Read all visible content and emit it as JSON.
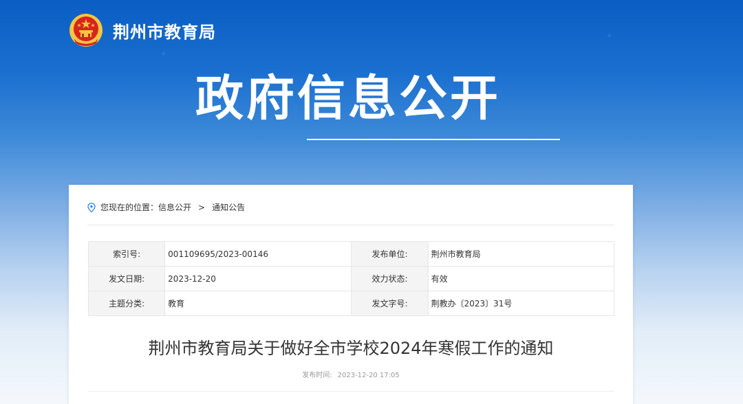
{
  "site": {
    "name": "荆州市教育局",
    "emblem_icon": "national-emblem-icon"
  },
  "hero": {
    "title": "政府信息公开"
  },
  "breadcrumb": {
    "icon": "location-pin-icon",
    "prefix": "您现在的位置：",
    "items": [
      "信息公开",
      "通知公告"
    ],
    "separator": ">"
  },
  "meta": {
    "index_no_label": "索引号:",
    "index_no_value": "001109695/2023-00146",
    "publisher_label": "发布单位:",
    "publisher_value": "荆州市教育局",
    "issue_date_label": "发文日期:",
    "issue_date_value": "2023-12-20",
    "validity_label": "效力状态:",
    "validity_value": "有效",
    "topic_label": "主题分类:",
    "topic_value": "教育",
    "doc_no_label": "发文字号:",
    "doc_no_value": "荆教办〔2023〕31号"
  },
  "article": {
    "title": "荆州市教育局关于做好全市学校2024年寒假工作的通知",
    "publish_label": "发布时间:",
    "publish_time": "2023-12-20 17:05"
  },
  "colors": {
    "banner_blue": "#0a5ec4",
    "emblem_red": "#d7251d",
    "emblem_gold": "#f5c542"
  }
}
